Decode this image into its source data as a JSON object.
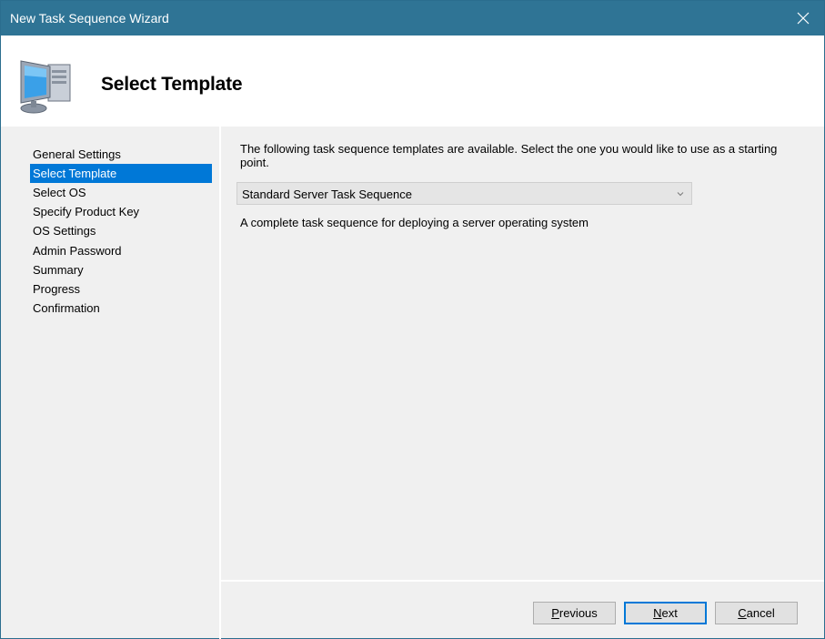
{
  "window": {
    "title": "New Task Sequence Wizard"
  },
  "header": {
    "title": "Select Template",
    "icon": "computer-icon"
  },
  "nav": {
    "items": [
      {
        "label": "General Settings",
        "active": false
      },
      {
        "label": "Select Template",
        "active": true
      },
      {
        "label": "Select OS",
        "active": false
      },
      {
        "label": "Specify Product Key",
        "active": false
      },
      {
        "label": "OS Settings",
        "active": false
      },
      {
        "label": "Admin Password",
        "active": false
      },
      {
        "label": "Summary",
        "active": false
      },
      {
        "label": "Progress",
        "active": false
      },
      {
        "label": "Confirmation",
        "active": false
      }
    ]
  },
  "main": {
    "description": "The following task sequence templates are available.  Select the one you would like to use as a starting point.",
    "template_select": {
      "value": "Standard Server Task Sequence"
    },
    "template_description": "A complete task sequence for deploying a server operating system"
  },
  "buttons": {
    "previous": {
      "accel": "P",
      "rest": "revious"
    },
    "next": {
      "accel": "N",
      "rest": "ext"
    },
    "cancel": {
      "accel": "C",
      "rest": "ancel"
    }
  },
  "colors": {
    "titlebar": "#2f7495",
    "selection": "#0078d7"
  }
}
